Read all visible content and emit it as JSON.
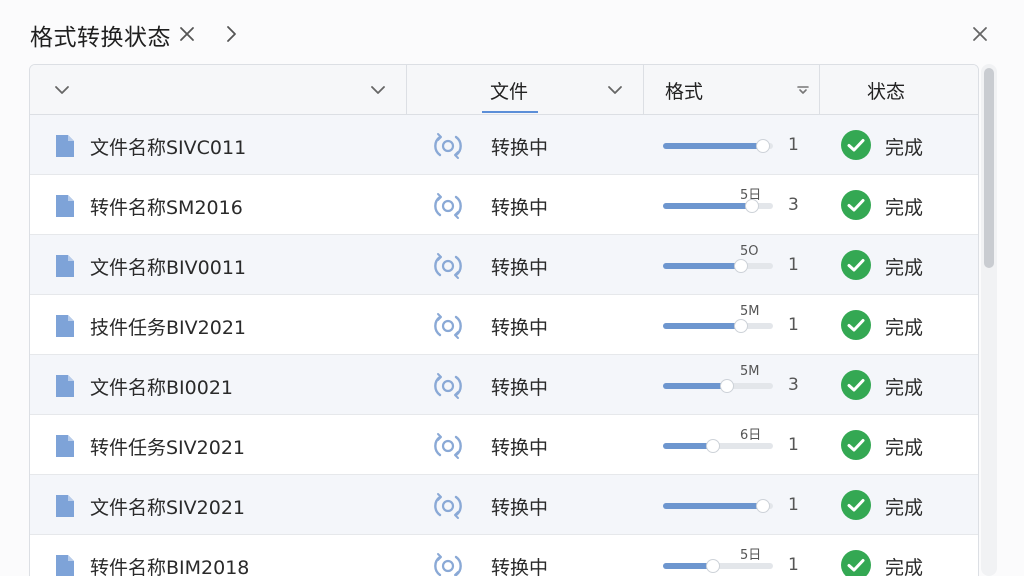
{
  "window": {
    "title": "格式转换状态"
  },
  "table": {
    "columns": [
      {
        "label": ""
      },
      {
        "label": ""
      },
      {
        "label": "文件"
      },
      {
        "label": "格式"
      },
      {
        "label": "状态"
      }
    ],
    "rows": [
      {
        "name": "文件名称SIVC011",
        "conversion": "转换中",
        "progress_label": "",
        "progress": 0.88,
        "count": "1",
        "status": "完成"
      },
      {
        "name": "转件名称SM2016",
        "conversion": "转换中",
        "progress_label": "5日",
        "progress": 0.78,
        "count": "3",
        "status": "完成"
      },
      {
        "name": "文件名称BIV0011",
        "conversion": "转换中",
        "progress_label": "5O",
        "progress": 0.68,
        "count": "1",
        "status": "完成"
      },
      {
        "name": "技件任务BIV2021",
        "conversion": "转换中",
        "progress_label": "5M",
        "progress": 0.68,
        "count": "1",
        "status": "完成"
      },
      {
        "name": "文件名称BI0021",
        "conversion": "转换中",
        "progress_label": "5M",
        "progress": 0.55,
        "count": "3",
        "status": "完成"
      },
      {
        "name": "转件任务SIV2021",
        "conversion": "转换中",
        "progress_label": "6日",
        "progress": 0.43,
        "count": "1",
        "status": "完成"
      },
      {
        "name": "文件名称SIV2021",
        "conversion": "转换中",
        "progress_label": "",
        "progress": 0.88,
        "count": "1",
        "status": "完成"
      },
      {
        "name": "转件名称BIM2018",
        "conversion": "转换中",
        "progress_label": "5日",
        "progress": 0.43,
        "count": "1",
        "status": "完成"
      }
    ]
  },
  "icons": {
    "file": "file-icon",
    "sync": "sync-icon",
    "status_done": "check-circle-icon",
    "close": "close-icon",
    "chevron": "chevron-right-icon"
  },
  "colors": {
    "accent": "#5b8ed8",
    "progress_fill": "#6d96cf",
    "file_icon": "#7ea3d8",
    "success": "#34a853"
  }
}
